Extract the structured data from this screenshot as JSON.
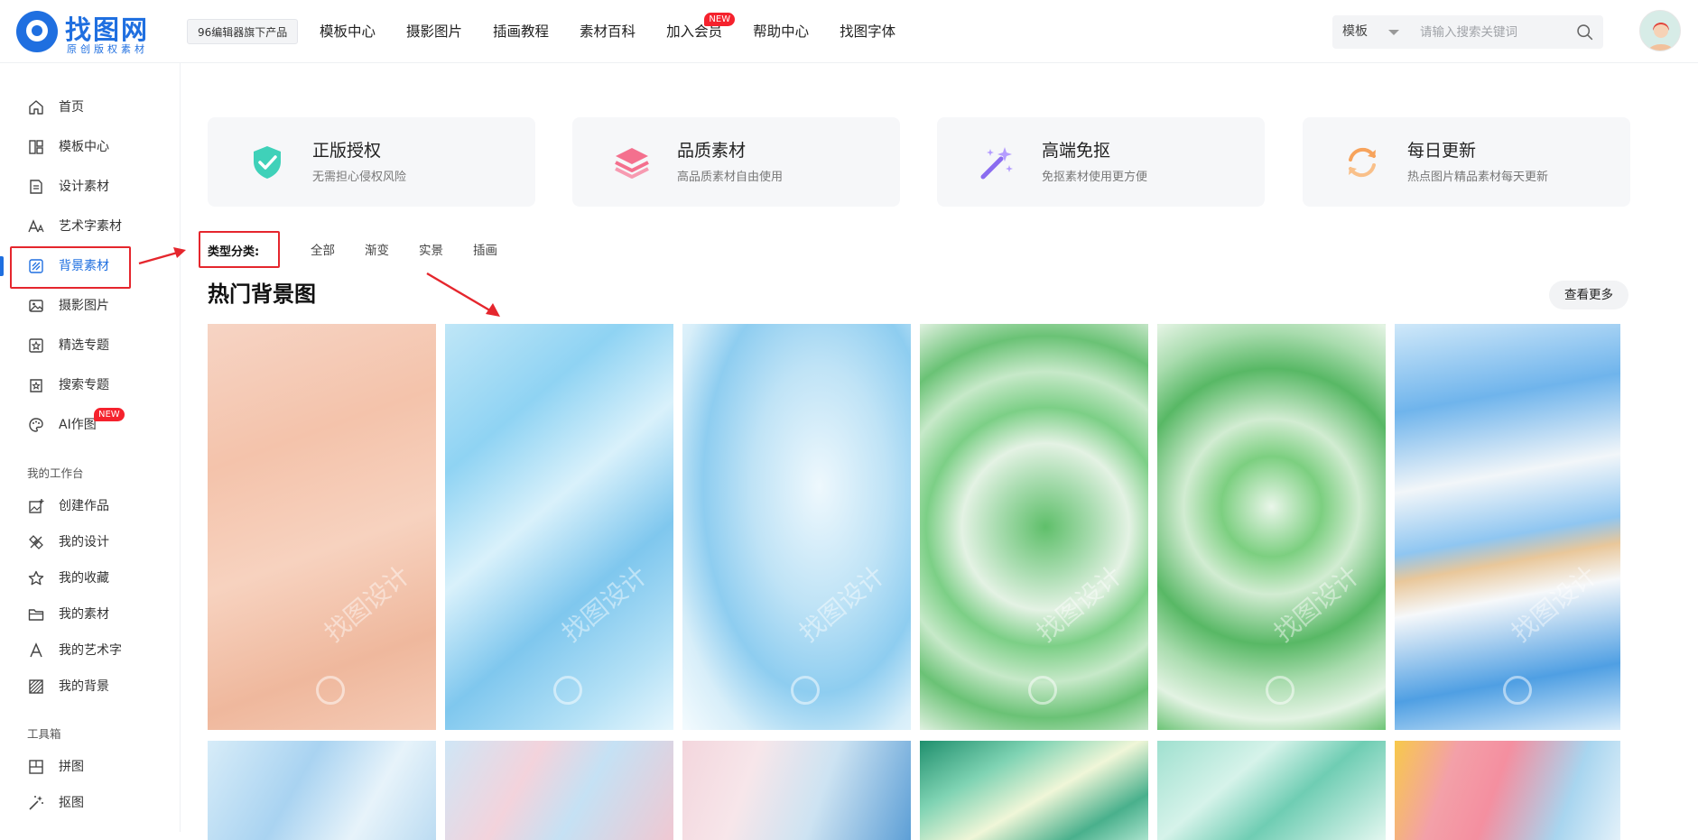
{
  "header": {
    "logo_title": "找图网",
    "logo_sub": "原创版权素材",
    "product_tag": "96编辑器旗下产品",
    "nav": [
      {
        "label": "模板中心"
      },
      {
        "label": "摄影图片"
      },
      {
        "label": "插画教程"
      },
      {
        "label": "素材百科"
      },
      {
        "label": "加入会员",
        "badge": "NEW"
      },
      {
        "label": "帮助中心"
      },
      {
        "label": "找图字体"
      }
    ],
    "search": {
      "category": "模板",
      "placeholder": "请输入搜索关键词"
    }
  },
  "sidebar": {
    "items": [
      {
        "label": "首页",
        "icon": "home-icon"
      },
      {
        "label": "模板中心",
        "icon": "template-icon"
      },
      {
        "label": "设计素材",
        "icon": "design-material-icon"
      },
      {
        "label": "艺术字素材",
        "icon": "art-text-icon"
      },
      {
        "label": "背景素材",
        "icon": "background-icon",
        "active": true
      },
      {
        "label": "摄影图片",
        "icon": "photo-icon"
      },
      {
        "label": "精选专题",
        "icon": "featured-topic-icon"
      },
      {
        "label": "搜索专题",
        "icon": "search-topic-icon"
      },
      {
        "label": "AI作图",
        "icon": "palette-icon",
        "badge": "NEW"
      }
    ],
    "workspace_title": "我的工作台",
    "workspace_items": [
      {
        "label": "创建作品",
        "icon": "create-work-icon"
      },
      {
        "label": "我的设计",
        "icon": "my-design-icon"
      },
      {
        "label": "我的收藏",
        "icon": "star-icon"
      },
      {
        "label": "我的素材",
        "icon": "folder-icon"
      },
      {
        "label": "我的艺术字",
        "icon": "letter-a-icon"
      },
      {
        "label": "我的背景",
        "icon": "pattern-icon"
      }
    ],
    "toolbox_title": "工具箱",
    "toolbox_items": [
      {
        "label": "拼图",
        "icon": "collage-icon"
      },
      {
        "label": "抠图",
        "icon": "magic-wand-icon"
      }
    ]
  },
  "features": [
    {
      "title": "正版授权",
      "desc": "无需担心侵权风险",
      "icon": "shield-check-icon",
      "color": "#3fd1b9"
    },
    {
      "title": "品质素材",
      "desc": "高品质素材自由使用",
      "icon": "layers-icon",
      "color": "#f4708e"
    },
    {
      "title": "高端免抠",
      "desc": "免抠素材使用更方便",
      "icon": "magic-wand-icon",
      "color": "#8a6cf0"
    },
    {
      "title": "每日更新",
      "desc": "热点图片精品素材每天更新",
      "icon": "refresh-icon",
      "color": "#f7a35c"
    }
  ],
  "filter": {
    "label": "类型分类:",
    "tabs": [
      "全部",
      "渐变",
      "实景",
      "插画"
    ]
  },
  "section": {
    "title": "热门背景图",
    "more": "查看更多"
  },
  "watermark": "找图设计",
  "colors": {
    "brand": "#1f6fe0",
    "highlight_red": "#e5262d",
    "badge_red": "#f5222d"
  }
}
